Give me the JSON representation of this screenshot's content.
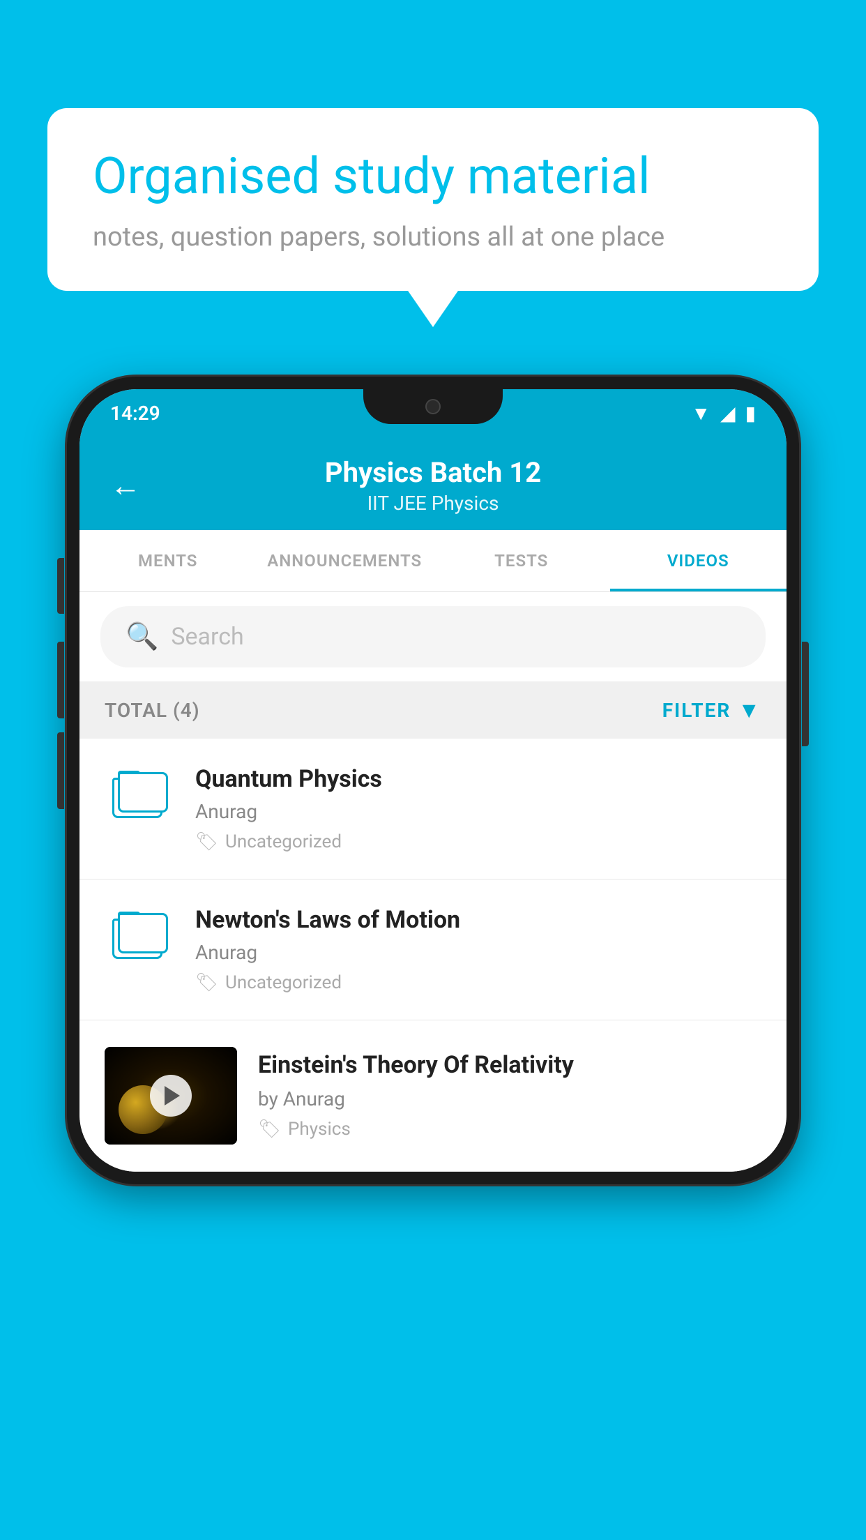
{
  "background_color": "#00BFEA",
  "speech_bubble": {
    "title": "Organised study material",
    "subtitle": "notes, question papers, solutions all at one place"
  },
  "phone": {
    "status_bar": {
      "time": "14:29",
      "icons": [
        "wifi",
        "signal",
        "battery"
      ]
    },
    "header": {
      "back_label": "←",
      "title": "Physics Batch 12",
      "subtitle": "IIT JEE    Physics"
    },
    "tabs": [
      {
        "label": "MENTS",
        "active": false
      },
      {
        "label": "ANNOUNCEMENTS",
        "active": false
      },
      {
        "label": "TESTS",
        "active": false
      },
      {
        "label": "VIDEOS",
        "active": true
      }
    ],
    "search": {
      "placeholder": "Search"
    },
    "filter": {
      "total_label": "TOTAL (4)",
      "filter_label": "FILTER"
    },
    "videos": [
      {
        "title": "Quantum Physics",
        "author": "Anurag",
        "tag": "Uncategorized",
        "has_thumbnail": false
      },
      {
        "title": "Newton's Laws of Motion",
        "author": "Anurag",
        "tag": "Uncategorized",
        "has_thumbnail": false
      },
      {
        "title": "Einstein's Theory Of Relativity",
        "author": "by Anurag",
        "tag": "Physics",
        "has_thumbnail": true
      }
    ]
  }
}
